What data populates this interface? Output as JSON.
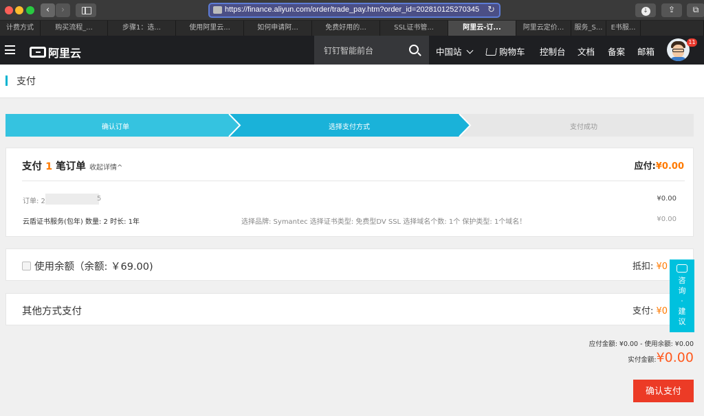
{
  "browser": {
    "url": "https://finance.aliyun.com/order/trade_pay.htm?order_id=202810125270345",
    "tabs": [
      {
        "label": "计费方式",
        "w": 59
      },
      {
        "label": "购买流程_...",
        "w": 98
      },
      {
        "label": "步骤1：选...",
        "w": 99
      },
      {
        "label": "使用阿里云...",
        "w": 99
      },
      {
        "label": "如何申请阿...",
        "w": 99
      },
      {
        "label": "免费好用的...",
        "w": 99
      },
      {
        "label": "SSL证书管...",
        "w": 99
      },
      {
        "label": "阿里云-订...",
        "w": 99,
        "active": true
      },
      {
        "label": "阿里云定价...",
        "w": 80
      },
      {
        "label": "服务_S...",
        "w": 51
      },
      {
        "label": "E书服...",
        "w": 50
      },
      {
        "label": "",
        "w": 62
      }
    ]
  },
  "header": {
    "logo_text": "阿里云",
    "search_placeholder": "钉钉智能前台",
    "region": "中国站",
    "cart": "购物车",
    "console": "控制台",
    "docs": "文档",
    "filing": "备案",
    "mail": "邮箱",
    "notification_count": "11"
  },
  "page": {
    "title": "支付"
  },
  "steps": [
    {
      "label": "确认订单",
      "state": "done"
    },
    {
      "label": "选择支付方式",
      "state": "current"
    },
    {
      "label": "支付成功",
      "state": "todo"
    }
  ],
  "order": {
    "heading_prefix": "支付",
    "heading_count": "1",
    "heading_suffix": "笔订单",
    "collapse_link": "收起详情^",
    "payable_label": "应付:",
    "payable_amount": "¥0.00",
    "order_id_label": "订单: 2",
    "order_id_tail": "5",
    "order_price": "¥0.00",
    "product_line": "云盾证书服务(包年) 数量: 2 时长: 1年",
    "product_spec": "选择品牌: Symantec 选择证书类型: 免费型DV SSL 选择域名个数: 1个 保护类型: 1个域名！",
    "product_price": "¥0.00"
  },
  "balance": {
    "label": "使用余额（余额: ￥69.00)",
    "deduct_label": "抵扣: ",
    "deduct_amount": "¥0"
  },
  "other_payment": {
    "label": "其他方式支付",
    "pay_label": "支付: ",
    "pay_amount": "¥0"
  },
  "consult": {
    "lines": [
      "咨",
      "询",
      "·",
      "建",
      "议"
    ]
  },
  "summary": {
    "line1": "应付金额: ¥0.00 - 使用余额: ¥0.00",
    "actual_label": "实付金额:",
    "actual_amount": "¥0.00",
    "confirm_button": "确认支付"
  },
  "colors": {
    "step_done": "#35c3e0",
    "step_current": "#1ab2d9",
    "step_todo": "#e7e7e7",
    "accent_orange": "#ff7a00",
    "confirm_red": "#ec3b26"
  }
}
